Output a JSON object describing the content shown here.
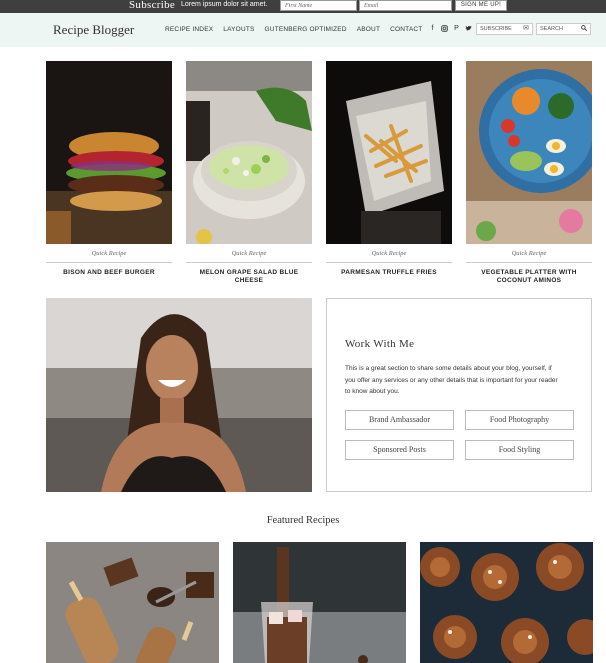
{
  "subscribe_bar": {
    "title": "Subscribe",
    "text": "Lorem ipsum dolor sit amet.",
    "first_name_placeholder": "First Name",
    "email_placeholder": "Email",
    "button_label": "SIGN ME UP!"
  },
  "header": {
    "logo": "Recipe Blogger",
    "nav": [
      "RECIPE INDEX",
      "LAYOUTS",
      "GUTENBERG OPTIMIZED",
      "ABOUT",
      "CONTACT"
    ],
    "social_icons": [
      "facebook-icon",
      "instagram-icon",
      "pinterest-icon",
      "twitter-icon"
    ],
    "subscribe_label": "SUBSCRIBE",
    "search_label": "SEARCH"
  },
  "recipes": [
    {
      "category": "Quick Recipe",
      "title": "BISON AND BEEF BURGER"
    },
    {
      "category": "Quick Recipe",
      "title": "MELON GRAPE SALAD BLUE CHEESE"
    },
    {
      "category": "Quick Recipe",
      "title": "PARMESAN TRUFFLE FRIES"
    },
    {
      "category": "Quick Recipe",
      "title": "VEGETABLE PLATTER WITH COCONUT AMINOS"
    }
  ],
  "work_with_me": {
    "heading": "Work With Me",
    "body": "This is a great section to share some details about your blog, yourself, if you offer any services or any other details that is important for your reader to know about you.",
    "buttons": [
      "Brand Ambassador",
      "Food Photography",
      "Sponsored Posts",
      "Food Styling"
    ]
  },
  "featured": {
    "title": "Featured Recipes"
  },
  "colors": {
    "subscribe_bar_bg": "#3f3f3f",
    "header_bg": "#eef6f3",
    "text": "#222222"
  }
}
